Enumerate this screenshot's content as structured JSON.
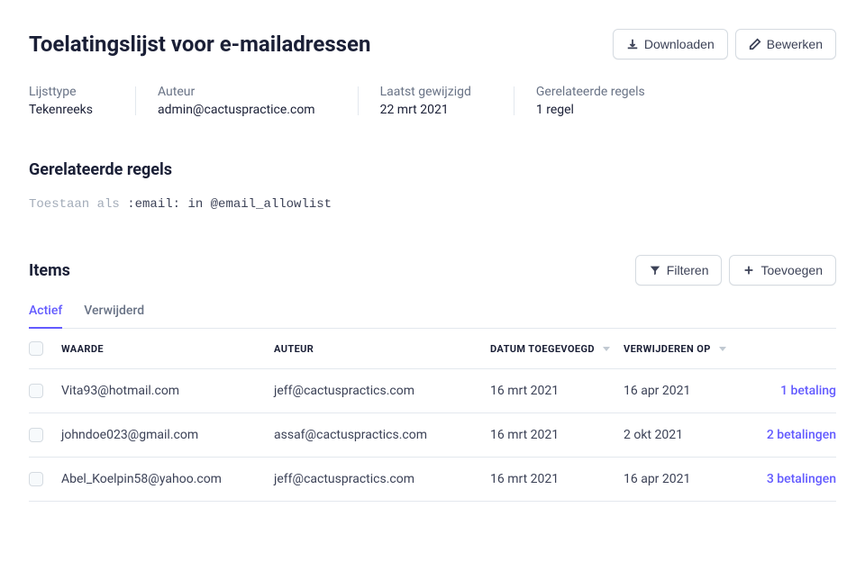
{
  "header": {
    "title": "Toelatingslijst voor e-mailadressen",
    "download_label": "Downloaden",
    "edit_label": "Bewerken"
  },
  "meta": {
    "list_type_label": "Lijsttype",
    "list_type_value": "Tekenreeks",
    "author_label": "Auteur",
    "author_value": "admin@cactuspractice.com",
    "modified_label": "Laatst gewijzigd",
    "modified_value": "22 mrt 2021",
    "related_label": "Gerelateerde regels",
    "related_value": "1 regel"
  },
  "related_section": {
    "title": "Gerelateerde regels",
    "rule_keyword": "Toestaan als",
    "rule_body": " :email: in @email_allowlist"
  },
  "items_section": {
    "title": "Items",
    "filter_label": "Filteren",
    "add_label": "Toevoegen",
    "tabs": {
      "active": "Actief",
      "removed": "Verwijderd"
    },
    "columns": {
      "value": "WAARDE",
      "author": "AUTEUR",
      "date_added": "DATUM TOEGEVOEGD",
      "remove_on": "VERWIJDEREN OP"
    },
    "rows": [
      {
        "value": "Vita93@hotmail.com",
        "author": "jeff@cactuspractics.com",
        "date_added": "16 mrt 2021",
        "remove_on": "16 apr 2021",
        "link": "1 betaling"
      },
      {
        "value": "johndoe023@gmail.com",
        "author": "assaf@cactuspractics.com",
        "date_added": "16 mrt 2021",
        "remove_on": "2 okt 2021",
        "link": "2 betalingen"
      },
      {
        "value": "Abel_Koelpin58@yahoo.com",
        "author": "jeff@cactuspractics.com",
        "date_added": "16 mrt 2021",
        "remove_on": "16 apr 2021",
        "link": "3 betalingen"
      }
    ]
  }
}
